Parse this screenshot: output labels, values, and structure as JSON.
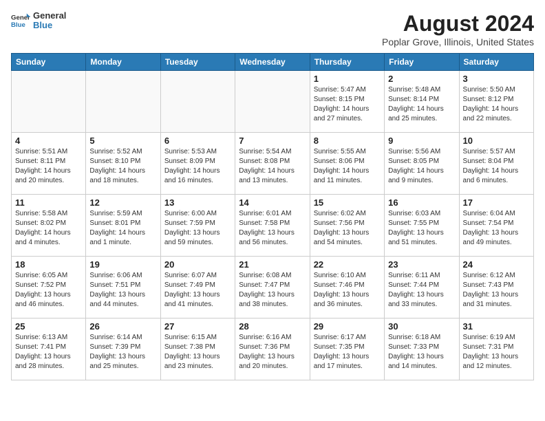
{
  "header": {
    "logo_general": "General",
    "logo_blue": "Blue",
    "month_year": "August 2024",
    "location": "Poplar Grove, Illinois, United States"
  },
  "days_of_week": [
    "Sunday",
    "Monday",
    "Tuesday",
    "Wednesday",
    "Thursday",
    "Friday",
    "Saturday"
  ],
  "weeks": [
    [
      {
        "day": "",
        "info": ""
      },
      {
        "day": "",
        "info": ""
      },
      {
        "day": "",
        "info": ""
      },
      {
        "day": "",
        "info": ""
      },
      {
        "day": "1",
        "info": "Sunrise: 5:47 AM\nSunset: 8:15 PM\nDaylight: 14 hours\nand 27 minutes."
      },
      {
        "day": "2",
        "info": "Sunrise: 5:48 AM\nSunset: 8:14 PM\nDaylight: 14 hours\nand 25 minutes."
      },
      {
        "day": "3",
        "info": "Sunrise: 5:50 AM\nSunset: 8:12 PM\nDaylight: 14 hours\nand 22 minutes."
      }
    ],
    [
      {
        "day": "4",
        "info": "Sunrise: 5:51 AM\nSunset: 8:11 PM\nDaylight: 14 hours\nand 20 minutes."
      },
      {
        "day": "5",
        "info": "Sunrise: 5:52 AM\nSunset: 8:10 PM\nDaylight: 14 hours\nand 18 minutes."
      },
      {
        "day": "6",
        "info": "Sunrise: 5:53 AM\nSunset: 8:09 PM\nDaylight: 14 hours\nand 16 minutes."
      },
      {
        "day": "7",
        "info": "Sunrise: 5:54 AM\nSunset: 8:08 PM\nDaylight: 14 hours\nand 13 minutes."
      },
      {
        "day": "8",
        "info": "Sunrise: 5:55 AM\nSunset: 8:06 PM\nDaylight: 14 hours\nand 11 minutes."
      },
      {
        "day": "9",
        "info": "Sunrise: 5:56 AM\nSunset: 8:05 PM\nDaylight: 14 hours\nand 9 minutes."
      },
      {
        "day": "10",
        "info": "Sunrise: 5:57 AM\nSunset: 8:04 PM\nDaylight: 14 hours\nand 6 minutes."
      }
    ],
    [
      {
        "day": "11",
        "info": "Sunrise: 5:58 AM\nSunset: 8:02 PM\nDaylight: 14 hours\nand 4 minutes."
      },
      {
        "day": "12",
        "info": "Sunrise: 5:59 AM\nSunset: 8:01 PM\nDaylight: 14 hours\nand 1 minute."
      },
      {
        "day": "13",
        "info": "Sunrise: 6:00 AM\nSunset: 7:59 PM\nDaylight: 13 hours\nand 59 minutes."
      },
      {
        "day": "14",
        "info": "Sunrise: 6:01 AM\nSunset: 7:58 PM\nDaylight: 13 hours\nand 56 minutes."
      },
      {
        "day": "15",
        "info": "Sunrise: 6:02 AM\nSunset: 7:56 PM\nDaylight: 13 hours\nand 54 minutes."
      },
      {
        "day": "16",
        "info": "Sunrise: 6:03 AM\nSunset: 7:55 PM\nDaylight: 13 hours\nand 51 minutes."
      },
      {
        "day": "17",
        "info": "Sunrise: 6:04 AM\nSunset: 7:54 PM\nDaylight: 13 hours\nand 49 minutes."
      }
    ],
    [
      {
        "day": "18",
        "info": "Sunrise: 6:05 AM\nSunset: 7:52 PM\nDaylight: 13 hours\nand 46 minutes."
      },
      {
        "day": "19",
        "info": "Sunrise: 6:06 AM\nSunset: 7:51 PM\nDaylight: 13 hours\nand 44 minutes."
      },
      {
        "day": "20",
        "info": "Sunrise: 6:07 AM\nSunset: 7:49 PM\nDaylight: 13 hours\nand 41 minutes."
      },
      {
        "day": "21",
        "info": "Sunrise: 6:08 AM\nSunset: 7:47 PM\nDaylight: 13 hours\nand 38 minutes."
      },
      {
        "day": "22",
        "info": "Sunrise: 6:10 AM\nSunset: 7:46 PM\nDaylight: 13 hours\nand 36 minutes."
      },
      {
        "day": "23",
        "info": "Sunrise: 6:11 AM\nSunset: 7:44 PM\nDaylight: 13 hours\nand 33 minutes."
      },
      {
        "day": "24",
        "info": "Sunrise: 6:12 AM\nSunset: 7:43 PM\nDaylight: 13 hours\nand 31 minutes."
      }
    ],
    [
      {
        "day": "25",
        "info": "Sunrise: 6:13 AM\nSunset: 7:41 PM\nDaylight: 13 hours\nand 28 minutes."
      },
      {
        "day": "26",
        "info": "Sunrise: 6:14 AM\nSunset: 7:39 PM\nDaylight: 13 hours\nand 25 minutes."
      },
      {
        "day": "27",
        "info": "Sunrise: 6:15 AM\nSunset: 7:38 PM\nDaylight: 13 hours\nand 23 minutes."
      },
      {
        "day": "28",
        "info": "Sunrise: 6:16 AM\nSunset: 7:36 PM\nDaylight: 13 hours\nand 20 minutes."
      },
      {
        "day": "29",
        "info": "Sunrise: 6:17 AM\nSunset: 7:35 PM\nDaylight: 13 hours\nand 17 minutes."
      },
      {
        "day": "30",
        "info": "Sunrise: 6:18 AM\nSunset: 7:33 PM\nDaylight: 13 hours\nand 14 minutes."
      },
      {
        "day": "31",
        "info": "Sunrise: 6:19 AM\nSunset: 7:31 PM\nDaylight: 13 hours\nand 12 minutes."
      }
    ]
  ]
}
